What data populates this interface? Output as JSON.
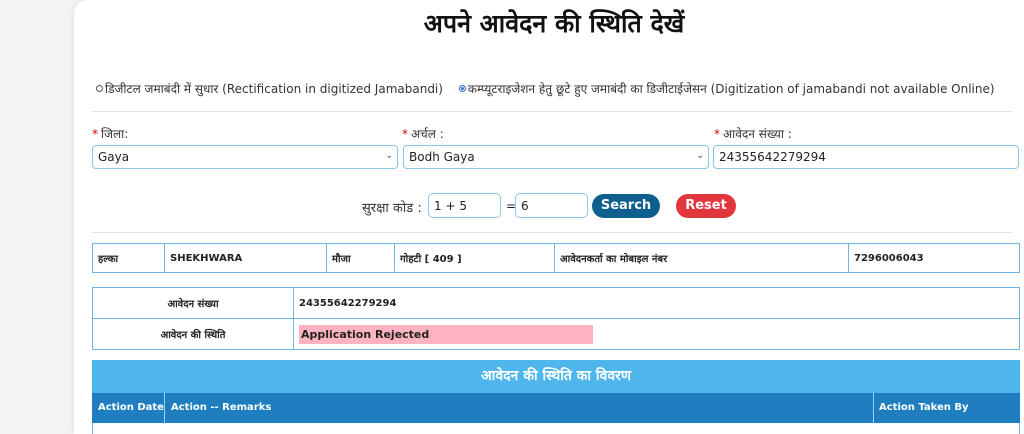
{
  "page_title": "अपने आवेदन की स्थिति देखें",
  "radio_options": [
    {
      "label": "डिजीटल जमाबंदी में सुधार (Rectification in digitized Jamabandi)",
      "selected": false
    },
    {
      "label": "कम्प्यूटराइजेशन हेतु छूटे हुए जमाबंदी का डिजीटाईजेसन (Digitization of jamabandi not available Online)",
      "selected": true
    }
  ],
  "form": {
    "district_label": "जिला:",
    "district_value": "Gaya",
    "circle_label": "अर्चल :",
    "circle_value": "Bodh Gaya",
    "application_no_label": "आवेदन संख्या :",
    "application_no_value": "24355642279294",
    "required_mark": "*"
  },
  "captcha": {
    "label": "सुरक्षा कोड :",
    "expression": "1 + 5",
    "equals": "=",
    "answer": "6",
    "search_label": "Search",
    "reset_label": "Reset"
  },
  "info_row": {
    "halka_label": "हल्का",
    "halka_value": "SHEKHWARA",
    "mauja_label": "मौजा",
    "mauja_value": "गोहटी [ 409 ]",
    "mobile_label": "आवेदनकर्ता का मोबाइल नंबर",
    "mobile_value": "7296006043"
  },
  "status_table": {
    "app_no_label": "आवेदन संख्या",
    "app_no_value": "24355642279294",
    "status_label": "आवेदन की स्थिति",
    "status_value": "Application Rejected"
  },
  "details": {
    "banner": "आवेदन की स्थिति का विवरण",
    "columns": [
      "Action Date",
      "Action -- Remarks",
      "Action Taken By"
    ]
  },
  "colors": {
    "search_button": "#0e5f8e",
    "reset_button": "#e2363d",
    "banner": "#4eb6ec",
    "table_header": "#1f7ec0",
    "rejected_highlight": "#ffb3c0"
  }
}
